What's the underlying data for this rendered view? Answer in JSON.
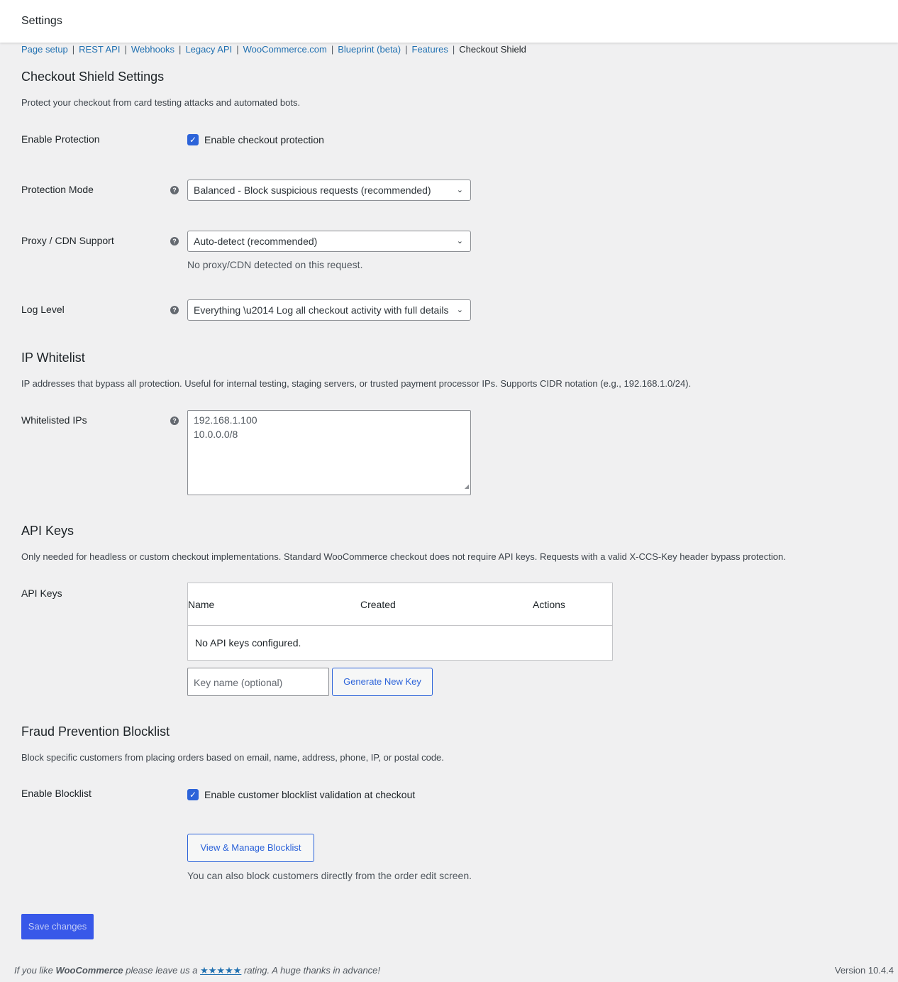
{
  "header": {
    "title": "Settings"
  },
  "subnav": {
    "items": [
      "Page setup",
      "REST API",
      "Webhooks",
      "Legacy API",
      "WooCommerce.com",
      "Blueprint (beta)",
      "Features"
    ],
    "current": "Checkout Shield",
    "separator": "|"
  },
  "settings": {
    "title": "Checkout Shield Settings",
    "description": "Protect your checkout from card testing attacks and automated bots.",
    "enable_protection": {
      "label": "Enable Protection",
      "checkbox_label": "Enable checkout protection",
      "checked": true
    },
    "protection_mode": {
      "label": "Protection Mode",
      "value": "Balanced - Block suspicious requests (recommended)"
    },
    "proxy_cdn": {
      "label": "Proxy / CDN Support",
      "value": "Auto-detect (recommended)",
      "note": "No proxy/CDN detected on this request."
    },
    "log_level": {
      "label": "Log Level",
      "value": "Everything \\u2014 Log all checkout activity with full details"
    }
  },
  "whitelist": {
    "title": "IP Whitelist",
    "description": "IP addresses that bypass all protection. Useful for internal testing, staging servers, or trusted payment processor IPs. Supports CIDR notation (e.g., 192.168.1.0/24).",
    "label": "Whitelisted IPs",
    "ips": [
      "192.168.1.100",
      "10.0.0.0/8"
    ]
  },
  "api_keys": {
    "title": "API Keys",
    "description": "Only needed for headless or custom checkout implementations. Standard WooCommerce checkout does not require API keys. Requests with a valid X-CCS-Key header bypass protection.",
    "label": "API Keys",
    "columns": [
      "Name",
      "Created",
      "Actions"
    ],
    "empty_text": "No API keys configured.",
    "key_name_placeholder": "Key name (optional)",
    "generate_button": "Generate New Key"
  },
  "blocklist": {
    "title": "Fraud Prevention Blocklist",
    "description": "Block specific customers from placing orders based on email, name, address, phone, IP, or postal code.",
    "label": "Enable Blocklist",
    "checkbox_label": "Enable customer blocklist validation at checkout",
    "checked": true,
    "manage_button": "View & Manage Blocklist",
    "note": "You can also block customers directly from the order edit screen."
  },
  "save_button": "Save changes",
  "footer": {
    "prefix": "If you like",
    "brand": "WooCommerce",
    "middle": "please leave us a",
    "stars": "★★★★★",
    "suffix": "rating. A huge thanks in advance!",
    "version": "Version 10.4.4"
  },
  "icons": {
    "help": "help-circle-icon",
    "check": "checkmark-icon",
    "chevron": "chevron-down-icon",
    "resize": "resize-grip-icon"
  },
  "colors": {
    "link": "#2271b1",
    "accent": "#3858e9",
    "checkbox": "#2c63d9",
    "background": "#f0f0f1"
  }
}
